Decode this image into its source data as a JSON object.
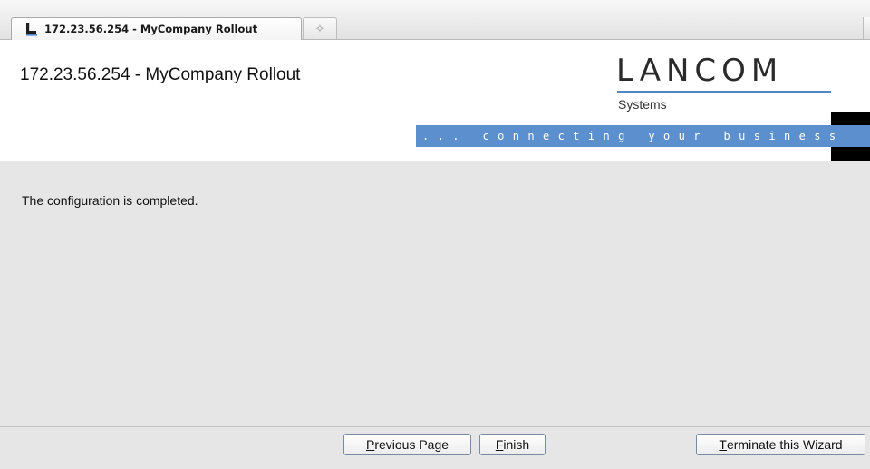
{
  "tab": {
    "title": "172.23.56.254 - MyCompany Rollout",
    "icon": "lancom-l-icon",
    "new_tab_symbol": "✧"
  },
  "header": {
    "title": "172.23.56.254 - MyCompany Rollout",
    "logo_text": "LANCOM",
    "logo_subtext": "Systems",
    "slogan": "... connecting your business",
    "accent_color": "#5b8fce"
  },
  "content": {
    "message": "The configuration is completed."
  },
  "footer": {
    "previous_accel": "P",
    "previous_rest": "revious Page",
    "finish_accel": "F",
    "finish_rest": "inish",
    "terminate_accel": "T",
    "terminate_rest": "erminate this Wizard"
  }
}
